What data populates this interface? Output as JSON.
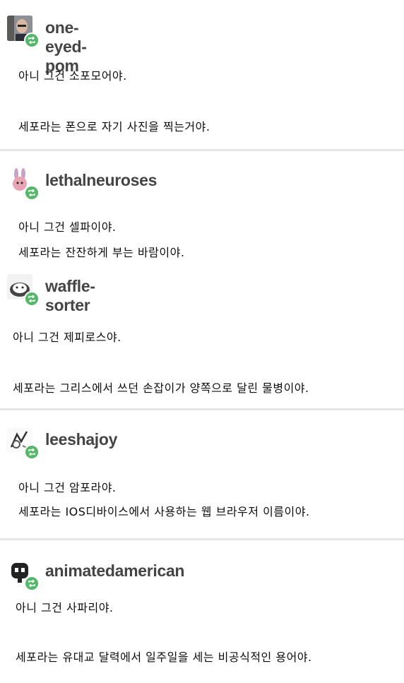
{
  "posts": [
    {
      "username": "one-eyed-pom",
      "avatar_icon": "man-photo-avatar",
      "lines": [
        "아니 그건 소포모어야.",
        "세포라는 폰으로 자기 사진을 찍는거야."
      ]
    },
    {
      "username": "lethalneuroses",
      "avatar_icon": "bunny-character-avatar",
      "lines": [
        "아니 그건 셀파이야.",
        "세포라는 잔잔하게 부는 바람이야."
      ]
    },
    {
      "username": "waffle-sorter",
      "avatar_icon": "cartoon-face-avatar",
      "lines": [
        "아니 그건 제피로스야.",
        "세포라는 그리스에서 쓰던 손잡이가 양쪽으로 달린 물병이야."
      ]
    },
    {
      "username": "leeshajoy",
      "avatar_icon": "sketch-drawing-avatar",
      "lines": [
        "아니 그건 암포라야.",
        "세포라는 IOS디바이스에서 사용하는 웹 브라우저 이름이야."
      ]
    },
    {
      "username": "animatedamerican",
      "avatar_icon": "robot-character-avatar",
      "lines": [
        "아니 그건 사파리야.",
        "세포라는 유대교 달력에서 일주일을 세는 비공식적인 용어야."
      ]
    }
  ],
  "reblog_icon": "reblog-icon",
  "colors": {
    "reblog": "#56b76a",
    "separator": "#e7e7e7",
    "username": "#444444"
  }
}
